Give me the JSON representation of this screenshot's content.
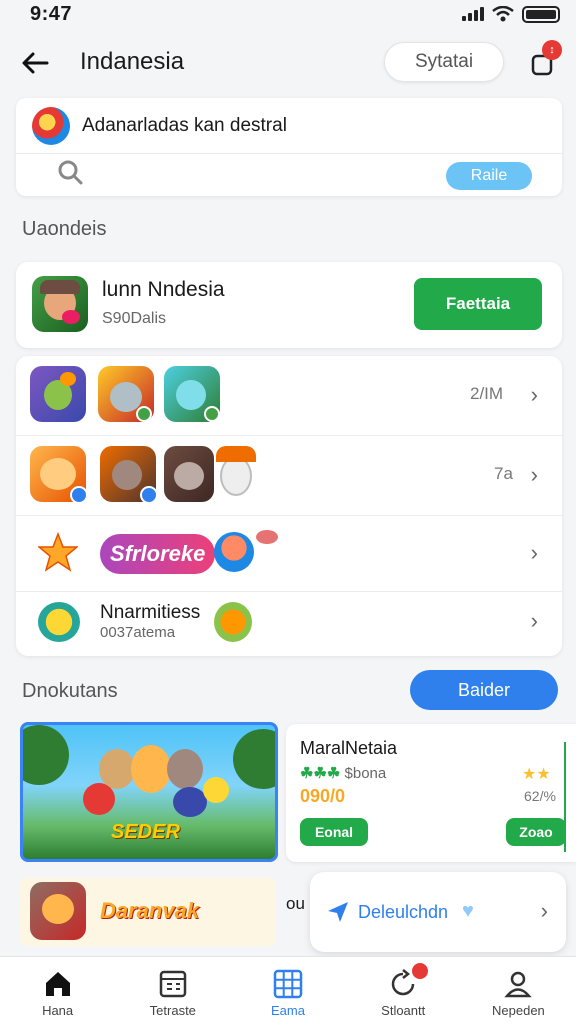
{
  "status_bar": {
    "time": "9:47"
  },
  "header": {
    "title": "Indanesia",
    "pill_label": "Sytatai",
    "notif_badge": "↕"
  },
  "search": {
    "query": "Adanarladas kan destral",
    "button_label": "Raile"
  },
  "section1": {
    "label": "Uaondeis"
  },
  "featured": {
    "title": "lunn Nndesia",
    "subtitle": "S90Dalis",
    "button_label": "Faettaia"
  },
  "list_rows": [
    {
      "count": "2/IM"
    },
    {
      "count": "7a"
    },
    {
      "logo_text": "Sfrloreke"
    },
    {
      "title": "Nnarmitiess",
      "subtitle": "0037atema"
    }
  ],
  "section2": {
    "label": "Dnokutans",
    "button_label": "Baider"
  },
  "promo": {
    "brand_text": "SEDER"
  },
  "info_card": {
    "title": "MaralNetaia",
    "rating_text": "$bona",
    "price": "090/0",
    "percent": "62/%",
    "left_button": "Eonal",
    "right_button": "Zoao"
  },
  "bottom_banner": {
    "text": "Daranvak",
    "caption": "ou"
  },
  "tooltip": {
    "label": "Deleulchdn"
  },
  "tabs": [
    {
      "label": "Hana",
      "icon": "home-icon"
    },
    {
      "label": "Tetraste",
      "icon": "calculator-icon"
    },
    {
      "label": "Eama",
      "icon": "grid-icon",
      "active": true
    },
    {
      "label": "Stloantt",
      "icon": "refresh-icon",
      "badge": true
    },
    {
      "label": "Nepeden",
      "icon": "user-icon"
    }
  ],
  "colors": {
    "accent_blue": "#2f80ed",
    "accent_green": "#22a94a",
    "badge_red": "#e53935"
  }
}
